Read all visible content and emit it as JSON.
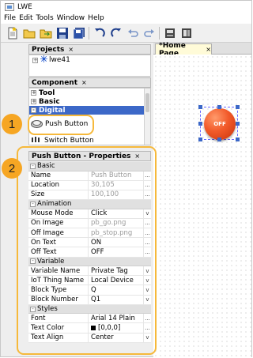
{
  "window": {
    "title": "LWE"
  },
  "menu": [
    "File",
    "Edit",
    "Tools",
    "Window",
    "Help"
  ],
  "toolbar": {
    "icons": [
      "new-file-icon",
      "open-folder-icon",
      "open-project-icon",
      "save-icon",
      "save-all-icon",
      "undo-icon",
      "redo-icon",
      "rotate-left-icon",
      "rotate-right-icon",
      "download-icon",
      "upload-icon"
    ]
  },
  "projects": {
    "title": "Projects",
    "close": "×",
    "tree": {
      "expander": "+",
      "label": "lwe41"
    }
  },
  "component": {
    "title": "Component",
    "close": "×",
    "categories": [
      {
        "expander": "+",
        "label": "Tool"
      },
      {
        "expander": "+",
        "label": "Basic"
      },
      {
        "expander": "-",
        "label": "Digital"
      }
    ],
    "items": [
      "Push Button",
      "Switch Button"
    ]
  },
  "canvas_tab": {
    "label": "*Home Page",
    "close": "×"
  },
  "widget": {
    "label": "OFF",
    "color": "#e8411a"
  },
  "properties": {
    "title": "Push Button - Properties",
    "close": "×",
    "sections": [
      {
        "name": "Basic",
        "rows": [
          {
            "name": "Name",
            "value": "Push Button",
            "disabled": true,
            "ctrl": "..."
          },
          {
            "name": "Location",
            "value": "30,105",
            "disabled": true,
            "ctrl": "..."
          },
          {
            "name": "Size",
            "value": "100,100",
            "disabled": true,
            "ctrl": "..."
          }
        ]
      },
      {
        "name": "Animation",
        "rows": [
          {
            "name": "Mouse Mode",
            "value": "Click",
            "ctrl": "v"
          },
          {
            "name": "On Image",
            "value": "pb_go.png",
            "disabled": true,
            "ctrl": "..."
          },
          {
            "name": "Off Image",
            "value": "pb_stop.png",
            "disabled": true,
            "ctrl": "..."
          },
          {
            "name": "On Text",
            "value": "ON",
            "ctrl": "..."
          },
          {
            "name": "Off Text",
            "value": "OFF",
            "ctrl": "..."
          }
        ]
      },
      {
        "name": "Variable",
        "rows": [
          {
            "name": "Variable Name",
            "value": "Private Tag",
            "ctrl": "v"
          },
          {
            "name": "IoT Thing Name",
            "value": "Local Device",
            "ctrl": "v"
          },
          {
            "name": "Block Type",
            "value": "Q",
            "ctrl": "v"
          },
          {
            "name": "Block Number",
            "value": "Q1",
            "ctrl": "v"
          }
        ]
      },
      {
        "name": "Styles",
        "rows": [
          {
            "name": "Font",
            "value": "Arial 14 Plain",
            "ctrl": "..."
          },
          {
            "name": "Text Color",
            "value": "[0,0,0]",
            "ctrl": "...",
            "swatch": true
          },
          {
            "name": "Text Align",
            "value": "Center",
            "ctrl": "v"
          }
        ]
      }
    ]
  },
  "callouts": [
    "1",
    "2"
  ],
  "colors": {
    "callout": "#f6a623",
    "selection": "#3c68c8"
  }
}
